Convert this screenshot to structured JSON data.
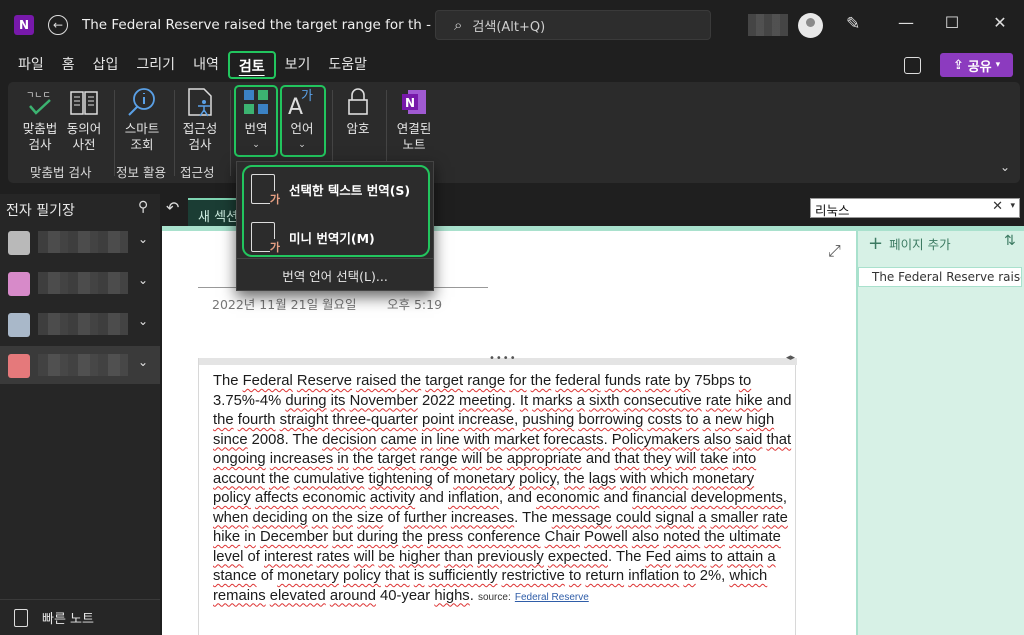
{
  "titlebar": {
    "app_icon": "N",
    "title": "The Federal Reserve raised the target range for th  -  OneNote",
    "search_placeholder": "검색(Alt+Q)",
    "min": "—",
    "max": "☐",
    "close": "✕"
  },
  "menu": {
    "tabs": [
      "파일",
      "홈",
      "삽입",
      "그리기",
      "내역",
      "검토",
      "보기",
      "도움말"
    ],
    "active": "검토",
    "share": "공유"
  },
  "ribbon": {
    "spelling": "맞춤법\n검사",
    "thesaurus": "동의어\n사전",
    "smart_lookup": "스마트\n조회",
    "accessibility": "접근성\n검사",
    "translate": "번역",
    "language": "언어",
    "password": "암호",
    "linked_notes": "연결된\n노트",
    "group_spelling": "맞춤법 검사",
    "group_insights": "정보 활용",
    "group_accessibility": "접근성"
  },
  "dropdown": {
    "item1": "선택한 텍스트 번역(S)",
    "item2": "미니 번역기(M)",
    "item3": "번역 언어 선택(L)..."
  },
  "sidebar": {
    "header": "전자 필기장",
    "quick_notes": "빠른 노트",
    "notebook_colors": [
      "#b9b9b9",
      "#d78ac9",
      "#a9b8c9",
      "#e5797b"
    ]
  },
  "section": {
    "tab": "새 섹션",
    "filter": "리눅스",
    "add_page": "페이지 추가"
  },
  "page": {
    "date": "2022년 11월 21일 월요일",
    "time": "오후 5:19",
    "list_entry": "The Federal Reserve raise",
    "source_label": "source:",
    "source_link": "Federal Reserve"
  }
}
